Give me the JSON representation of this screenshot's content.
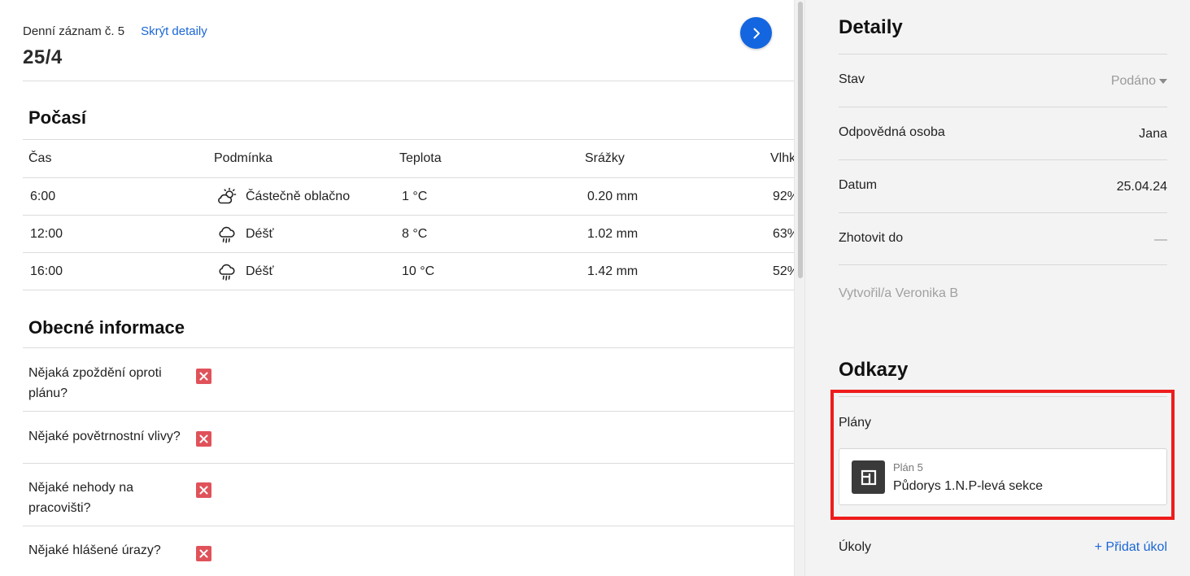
{
  "header": {
    "subtitle": "Denní záznam č. 5",
    "toggle_link": "Skrýt detaily",
    "title": "25/4"
  },
  "weather": {
    "title": "Počasí",
    "columns": [
      "Čas",
      "Podmínka",
      "Teplota",
      "Srážky",
      "Vlhk"
    ],
    "rows": [
      {
        "time": "6:00",
        "condition": "Částečně oblačno",
        "icon": "partly-cloudy-icon",
        "temp": "1 °C",
        "precip": "0.20 mm",
        "humidity": "92%"
      },
      {
        "time": "12:00",
        "condition": "Déšť",
        "icon": "rain-icon",
        "temp": "8 °C",
        "precip": "1.02 mm",
        "humidity": "63%"
      },
      {
        "time": "16:00",
        "condition": "Déšť",
        "icon": "rain-icon",
        "temp": "10 °C",
        "precip": "1.42 mm",
        "humidity": "52%"
      }
    ]
  },
  "general": {
    "title": "Obecné informace",
    "items": [
      {
        "question": "Nějaká zpoždění oproti plánu?",
        "answer_icon": "x-icon"
      },
      {
        "question": "Nějaké povětrnostní vlivy?",
        "answer_icon": "x-icon"
      },
      {
        "question": "Nějaké nehody na pracovišti?",
        "answer_icon": "x-icon"
      },
      {
        "question": "Nějaké hlášené úrazy?",
        "answer_icon": "x-icon"
      }
    ]
  },
  "details": {
    "title": "Detaily",
    "rows": [
      {
        "label": "Stav",
        "value": "Podáno"
      },
      {
        "label": "Odpovědná osoba",
        "value": "Jana"
      },
      {
        "label": "Datum",
        "value": "25.04.24"
      },
      {
        "label": "Zhotovit do",
        "value": "—"
      }
    ],
    "creator": "Vytvořil/a Veronika B"
  },
  "links": {
    "title": "Odkazy",
    "plans_label": "Plány",
    "plan": {
      "number": "Plán 5",
      "name": "Půdorys 1.N.P-levá sekce",
      "icon": "floorplan-icon"
    },
    "tasks_label": "Úkoly",
    "add_task": "+ Přidat úkol"
  },
  "colors": {
    "accent": "#1a66d6",
    "button": "#1466e0",
    "negative": "#e0525a",
    "highlight": "#ee1c1c"
  }
}
